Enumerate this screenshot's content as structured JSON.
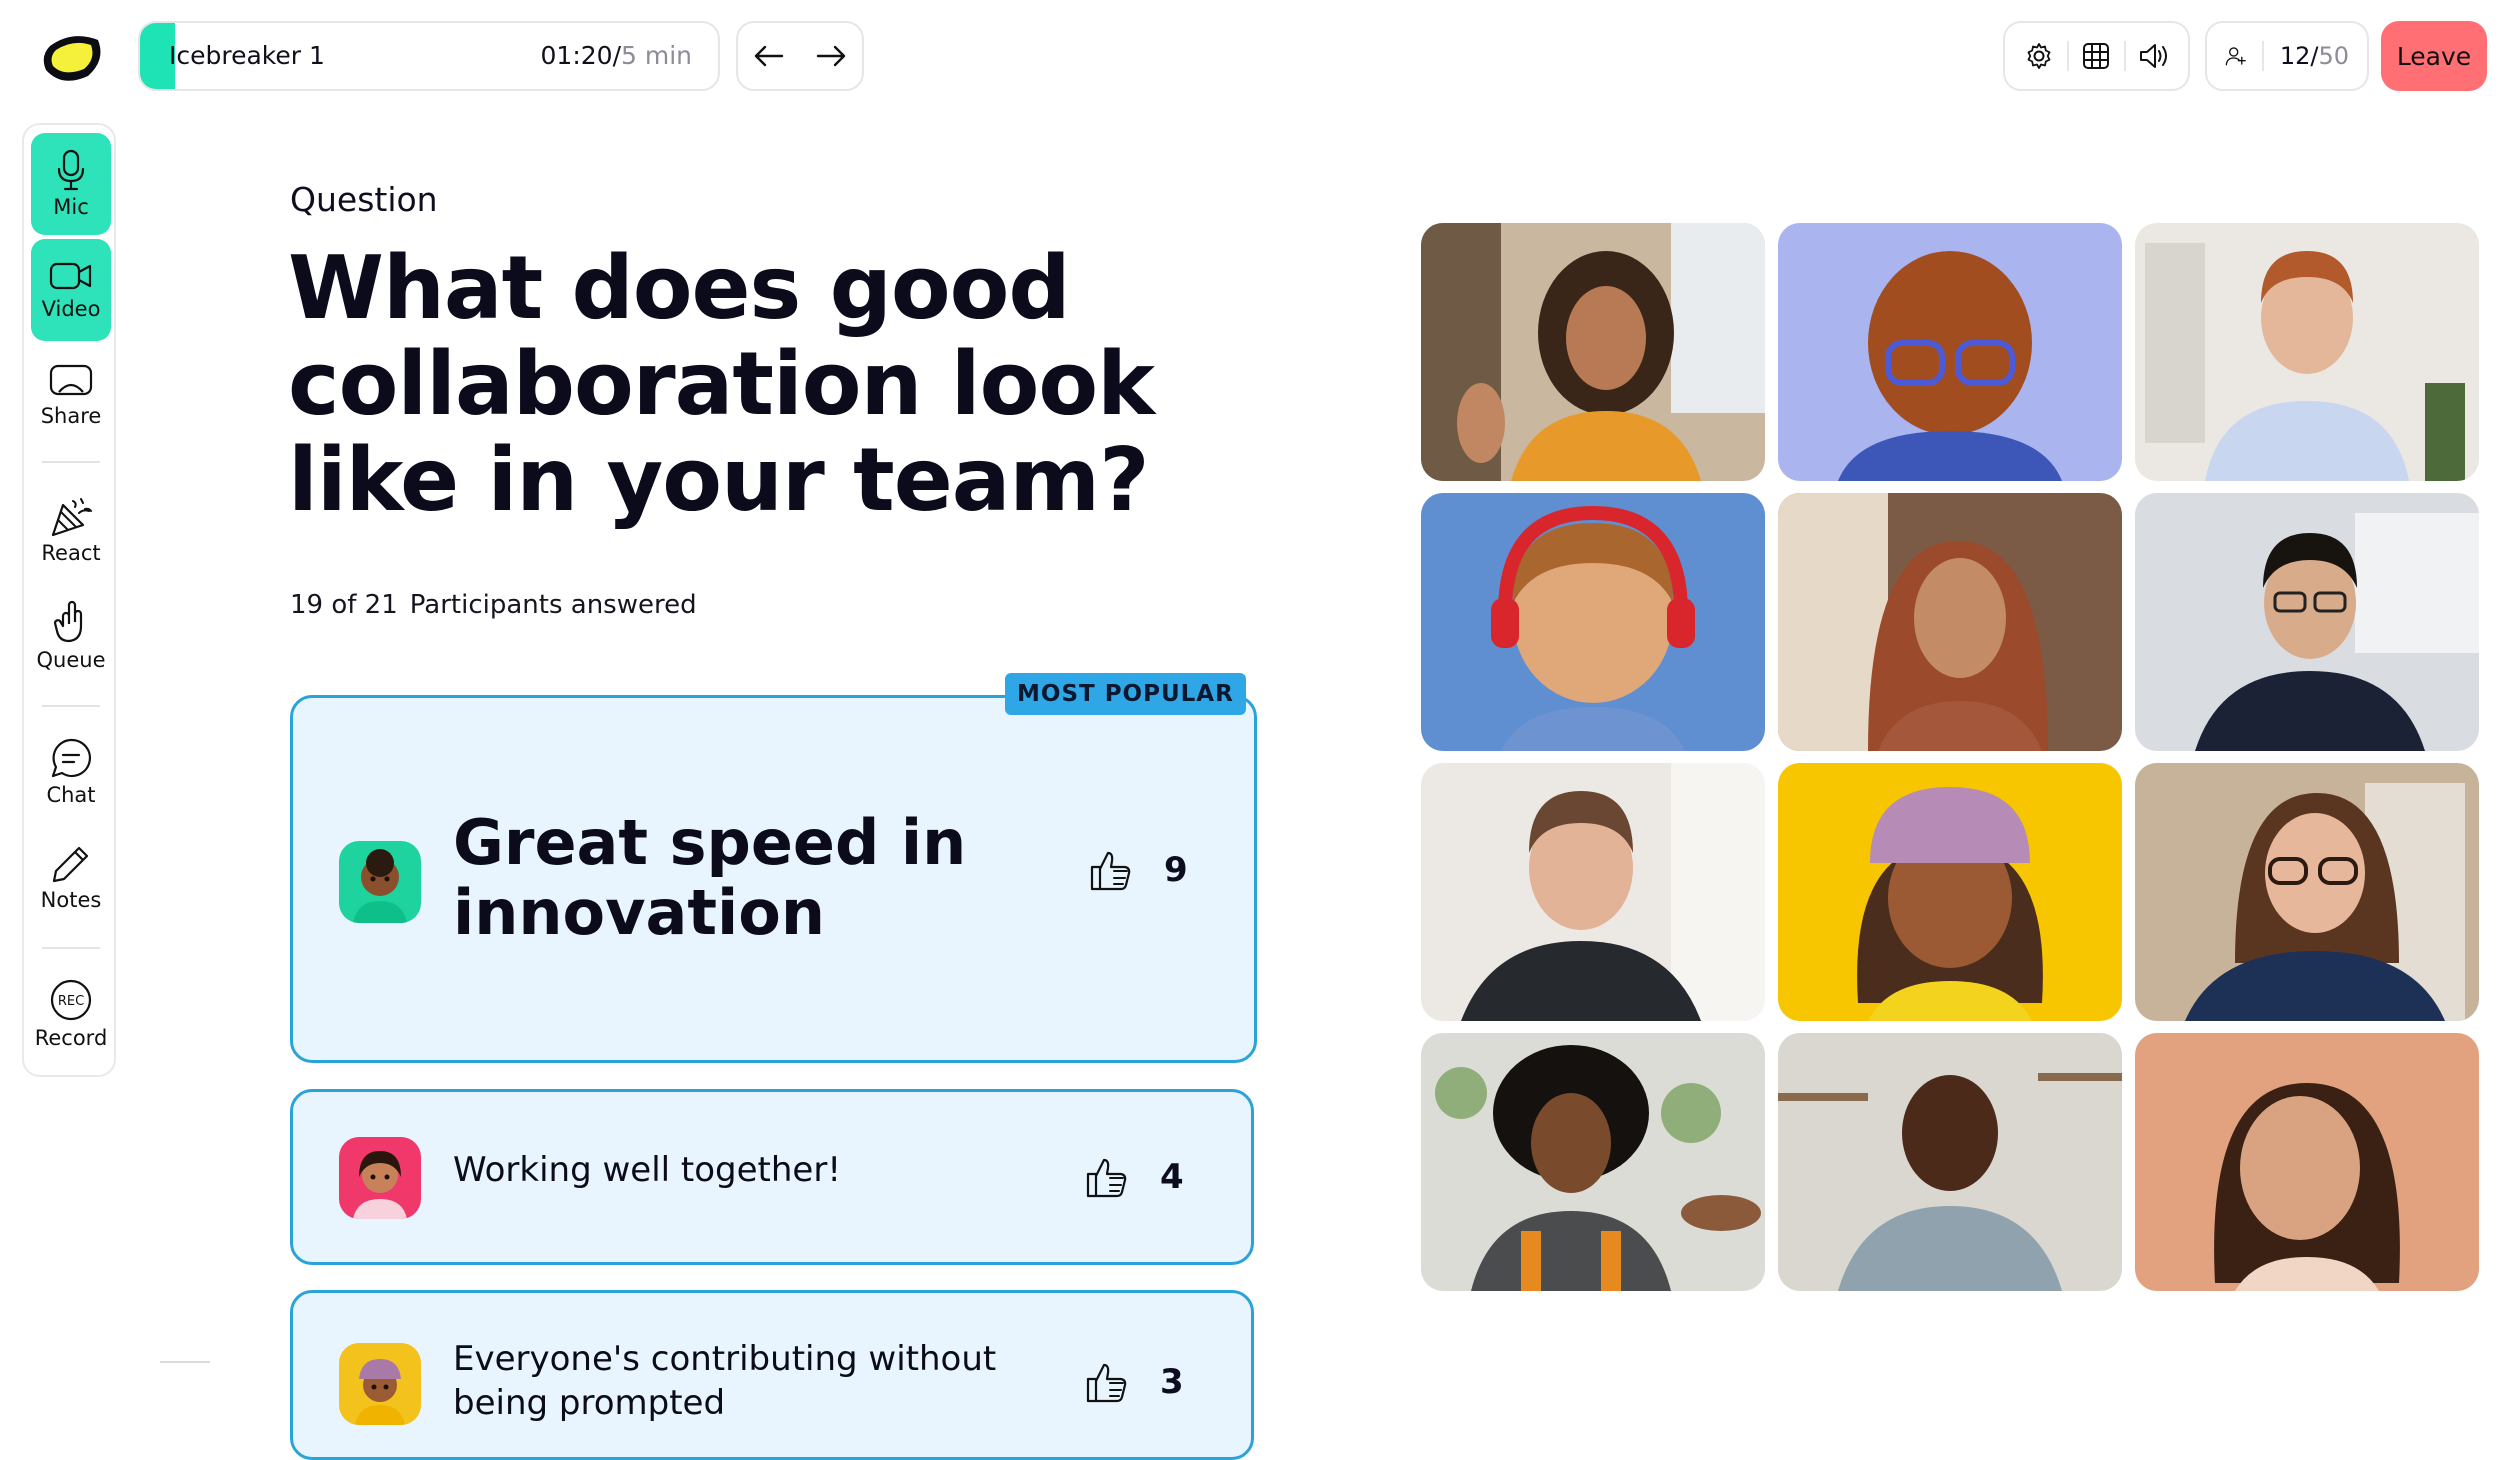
{
  "topbar": {
    "activity_name": "Icebreaker 1",
    "timer_elapsed": "01:20",
    "timer_separator": "/",
    "timer_total": "5 min",
    "timer_progress_fraction": 0.06,
    "participant_count": "12",
    "participant_separator": "/",
    "participant_capacity": "50",
    "leave_label": "Leave",
    "accent_color": "#1ee3b4",
    "leave_color": "#ff6f73"
  },
  "sidebar": {
    "items": [
      {
        "label": "Mic",
        "icon": "microphone-icon",
        "active": true
      },
      {
        "label": "Video",
        "icon": "video-camera-icon",
        "active": true
      },
      {
        "label": "Share",
        "icon": "screen-share-icon",
        "active": false
      },
      {
        "label": "React",
        "icon": "party-popper-icon",
        "active": false
      },
      {
        "label": "Queue",
        "icon": "raised-hand-icon",
        "active": false
      },
      {
        "label": "Chat",
        "icon": "chat-bubble-icon",
        "active": false
      },
      {
        "label": "Notes",
        "icon": "pencil-icon",
        "active": false
      },
      {
        "label": "Record",
        "icon": "rec-icon",
        "rec_text": "REC",
        "active": false
      }
    ]
  },
  "question": {
    "label": "Question",
    "title": "What does good collaboration look like in your team?",
    "answered_count": "19 of 21",
    "answered_label": "Participants answered"
  },
  "answers": [
    {
      "text": "Great speed in innovation",
      "votes": "9",
      "badge": "MOST POPULAR",
      "avatar_color": "#1fd39e"
    },
    {
      "text": "Working well together!",
      "votes": "4",
      "avatar_color": "#f0386b"
    },
    {
      "text": "Everyone's contributing without being prompted",
      "votes": "3",
      "avatar_color": "#f3c21d"
    }
  ],
  "video_tiles": [
    {
      "type": "photo",
      "bg": "#b9a48a"
    },
    {
      "type": "avatar",
      "bg": "#aab4ee"
    },
    {
      "type": "photo",
      "bg": "#e8e4de"
    },
    {
      "type": "avatar",
      "bg": "#5f8fd0"
    },
    {
      "type": "photo",
      "bg": "#8a6c55"
    },
    {
      "type": "photo",
      "bg": "#cfd2d6"
    },
    {
      "type": "photo",
      "bg": "#e6e2dc"
    },
    {
      "type": "avatar",
      "bg": "#f7c600"
    },
    {
      "type": "photo",
      "bg": "#c8b9a6"
    },
    {
      "type": "photo",
      "bg": "#d9dcd6"
    },
    {
      "type": "photo",
      "bg": "#d8d4cf"
    },
    {
      "type": "avatar",
      "bg": "#e2a17f"
    }
  ]
}
